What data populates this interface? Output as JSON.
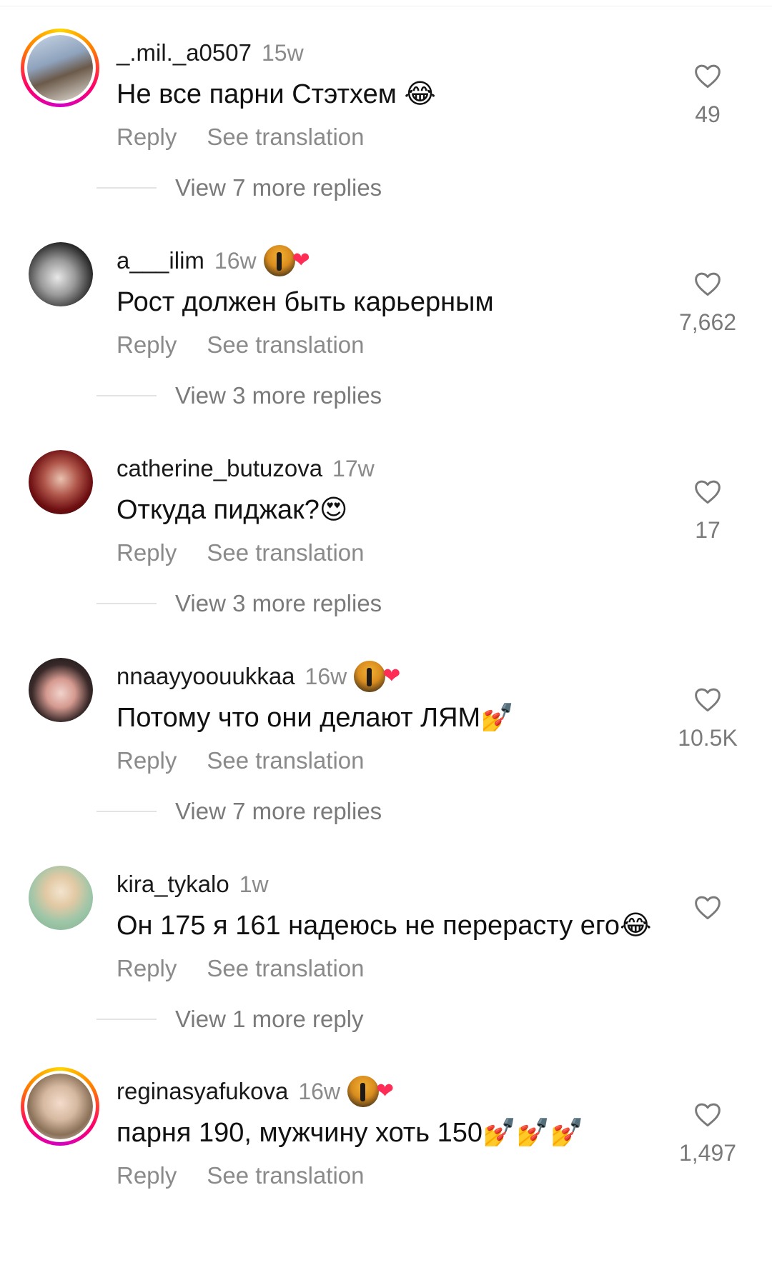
{
  "reply_label": "Reply",
  "translate_label": "See translation",
  "comments": [
    {
      "username": "_.mil._a0507",
      "time": "15w",
      "text": "Не все парни Стэтхем 😂",
      "likes": "49",
      "creator_liked": false,
      "story_ring": true,
      "view_replies": "View 7 more replies"
    },
    {
      "username": "a___ilim",
      "time": "16w",
      "text": "Рост должен быть карьерным",
      "likes": "7,662",
      "creator_liked": true,
      "story_ring": false,
      "view_replies": "View 3 more replies"
    },
    {
      "username": "catherine_butuzova",
      "time": "17w",
      "text": "Откуда пиджак?😍",
      "likes": "17",
      "creator_liked": false,
      "story_ring": false,
      "view_replies": "View 3 more replies"
    },
    {
      "username": "nnaayyoouukkaa",
      "time": "16w",
      "text": "Потому что они делают ЛЯМ💅",
      "likes": "10.5K",
      "creator_liked": true,
      "story_ring": false,
      "view_replies": "View 7 more replies"
    },
    {
      "username": "kira_tykalo",
      "time": "1w",
      "text": "Он 175 я 161 надеюсь не перерасту его😂",
      "likes": "",
      "creator_liked": false,
      "story_ring": false,
      "view_replies": "View 1 more reply"
    },
    {
      "username": "reginasyafukova",
      "time": "16w",
      "text": "парня 190, мужчину хоть 150💅💅💅",
      "likes": "1,497",
      "creator_liked": true,
      "story_ring": true,
      "view_replies": ""
    }
  ],
  "colors": {
    "secondary_text": "#8a8a8a",
    "heart_red": "#ff2d55",
    "ring_gradient": [
      "#ffd600",
      "#ff7a00",
      "#ff0069",
      "#d300c5"
    ]
  }
}
